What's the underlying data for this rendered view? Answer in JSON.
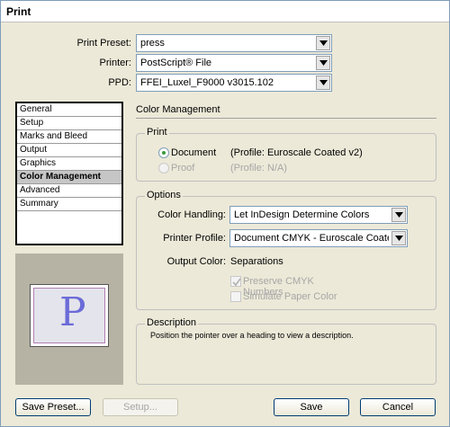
{
  "window": {
    "title": "Print"
  },
  "fields": {
    "preset": {
      "label": "Print Preset:",
      "value": "press"
    },
    "printer": {
      "label": "Printer:",
      "value": "PostScript® File"
    },
    "ppd": {
      "label": "PPD:",
      "value": "FFEI_Luxel_F9000 v3015.102"
    }
  },
  "nav": {
    "items": [
      {
        "label": "General"
      },
      {
        "label": "Setup"
      },
      {
        "label": "Marks and Bleed"
      },
      {
        "label": "Output"
      },
      {
        "label": "Graphics"
      },
      {
        "label": "Color Management",
        "selected": true
      },
      {
        "label": "Advanced"
      },
      {
        "label": "Summary"
      }
    ]
  },
  "preview": {
    "letter": "P"
  },
  "panel": {
    "heading": "Color Management",
    "print": {
      "title": "Print",
      "document_label": "Document",
      "document_profile": "(Profile: Euroscale Coated v2)",
      "proof_label": "Proof",
      "proof_profile": "(Profile: N/A)"
    },
    "options": {
      "title": "Options",
      "color_handling_label": "Color Handling:",
      "color_handling_value": "Let InDesign Determine Colors",
      "printer_profile_label": "Printer Profile:",
      "printer_profile_value": "Document CMYK - Euroscale Coated v",
      "output_color_label": "Output Color:",
      "output_color_value": "Separations",
      "preserve_label": "Preserve CMYK Numbers",
      "simulate_label": "Simulate Paper Color"
    },
    "description": {
      "title": "Description",
      "text": "Position the pointer over a heading to view a description."
    }
  },
  "buttons": {
    "save_preset": "Save Preset...",
    "setup": "Setup...",
    "save": "Save",
    "cancel": "Cancel"
  }
}
